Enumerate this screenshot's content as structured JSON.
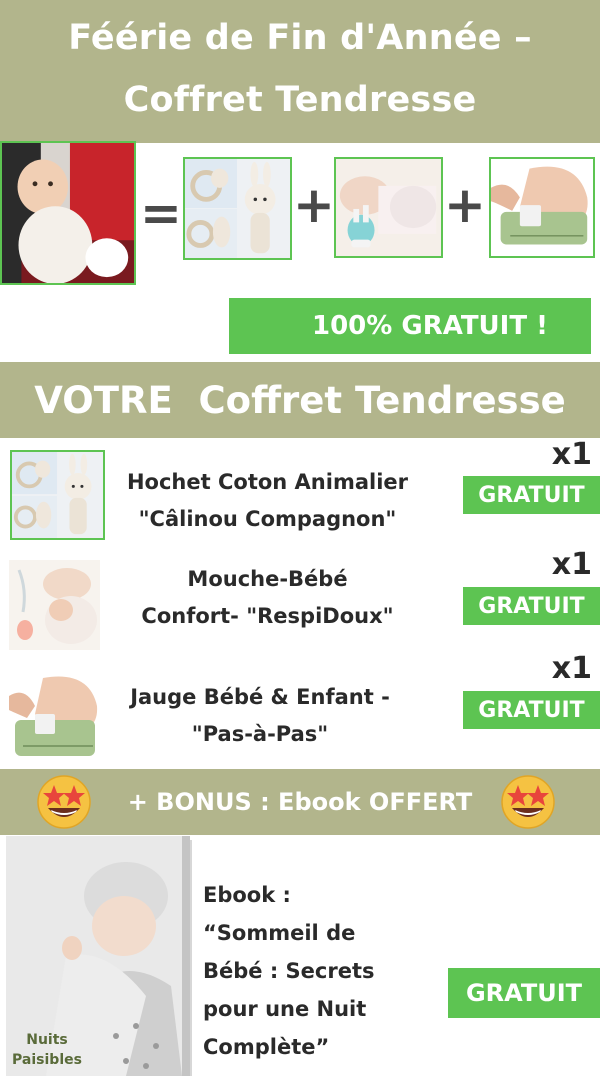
{
  "header": {
    "title_line1": "Féérie de Fin d'Année –",
    "title_line2": "Coffret Tendresse"
  },
  "equation": {
    "equals": "=",
    "plus": "+"
  },
  "promo": {
    "label": "100% GRATUIT !"
  },
  "section": {
    "title": "VOTRE  Coffret Tendresse"
  },
  "items": [
    {
      "name_line1": "Hochet Coton Animalier",
      "name_line2": "\"Câlinou Compagnon\"",
      "quantity": "x1",
      "price": "GRATUIT"
    },
    {
      "name_line1": "Mouche-Bébé",
      "name_line2": "Confort- \"RespiDoux\"",
      "quantity": "x1",
      "price": "GRATUIT"
    },
    {
      "name_line1": "Jauge  Bébé & Enfant -",
      "name_line2": "\"Pas-à-Pas\"",
      "quantity": "x1",
      "price": "GRATUIT"
    }
  ],
  "bonus": {
    "label": "+ BONUS : Ebook OFFERT"
  },
  "ebook": {
    "cover_caption_line1": "Nuits",
    "cover_caption_line2": "Paisibles",
    "line1": "Ebook :",
    "line2": "“Sommeil de",
    "line3": "Bébé : Secrets",
    "line4": "pour une Nuit",
    "line5": "Complète”",
    "price": "GRATUIT"
  },
  "colors": {
    "band": "#b2b58c",
    "accent_green": "#5dc452",
    "white": "#ffffff"
  },
  "icons": [
    "baby-photo",
    "rattle-toys-photo",
    "nasal-aspirator-photo",
    "foot-gauge-photo",
    "star-struck-emoji",
    "ebook-cover"
  ]
}
